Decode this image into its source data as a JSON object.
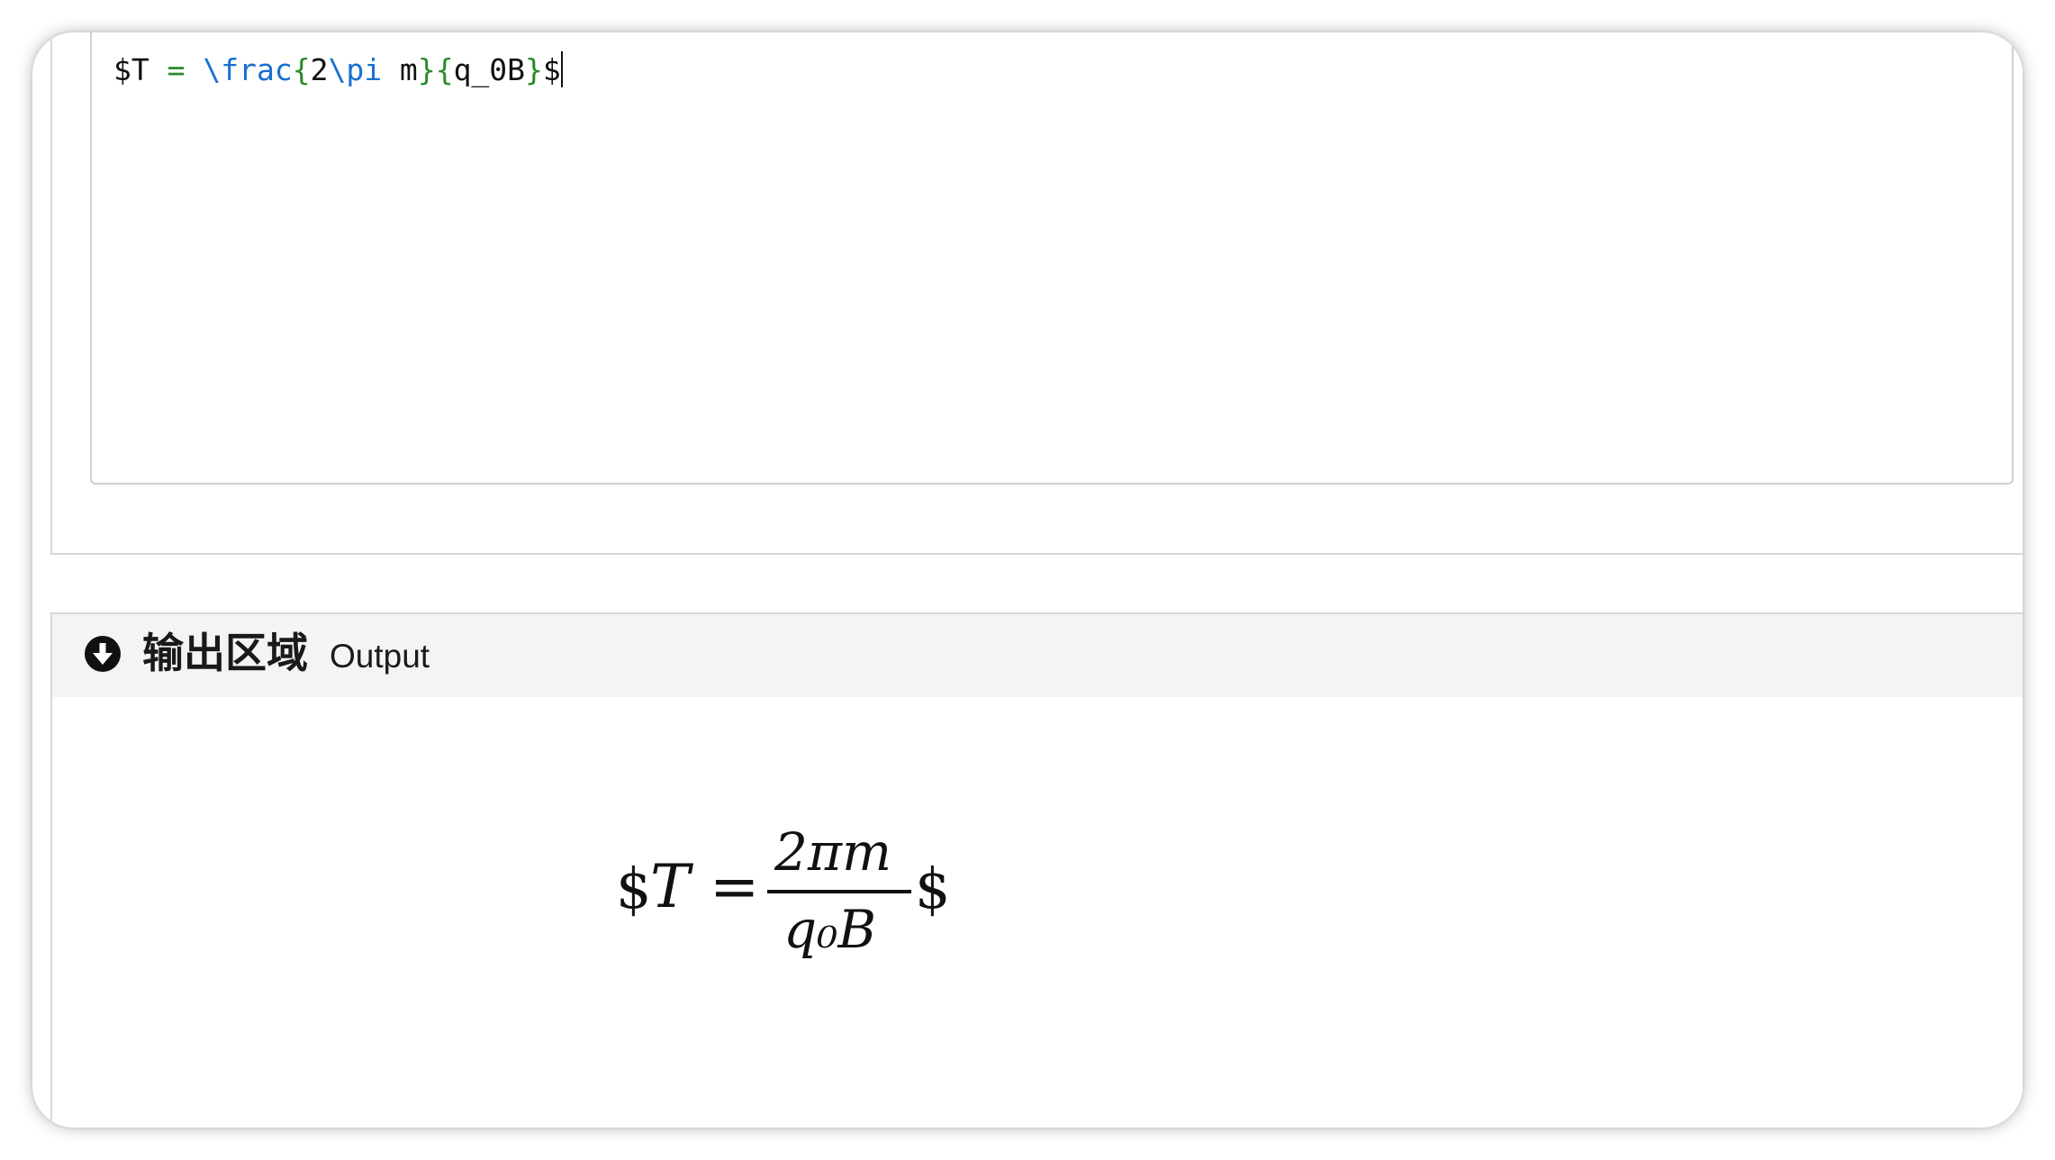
{
  "editor": {
    "code": "$T = \\frac{2\\pi m}{q_0B}$",
    "tokens": {
      "t1": "$T ",
      "t2": "=",
      "t3": " ",
      "t4": "\\frac",
      "t5": "{",
      "t6": "2",
      "t7": "\\pi",
      "t8": " m",
      "t9": "}",
      "t10": "{",
      "t11": "q_0B",
      "t12": "}",
      "t13": "$"
    }
  },
  "output": {
    "title_cn": "输出区域",
    "title_en": "Output",
    "icon": "arrow-circle-down-icon",
    "rendered": {
      "open_dollar": "$",
      "lhs": "T",
      "equals": "=",
      "numerator": "2πm",
      "denominator": "q₀B",
      "close_dollar": "$"
    }
  },
  "colors": {
    "command": "#1a6fd0",
    "operator": "#2a8a2a",
    "header_bg": "#f4f4f4"
  }
}
